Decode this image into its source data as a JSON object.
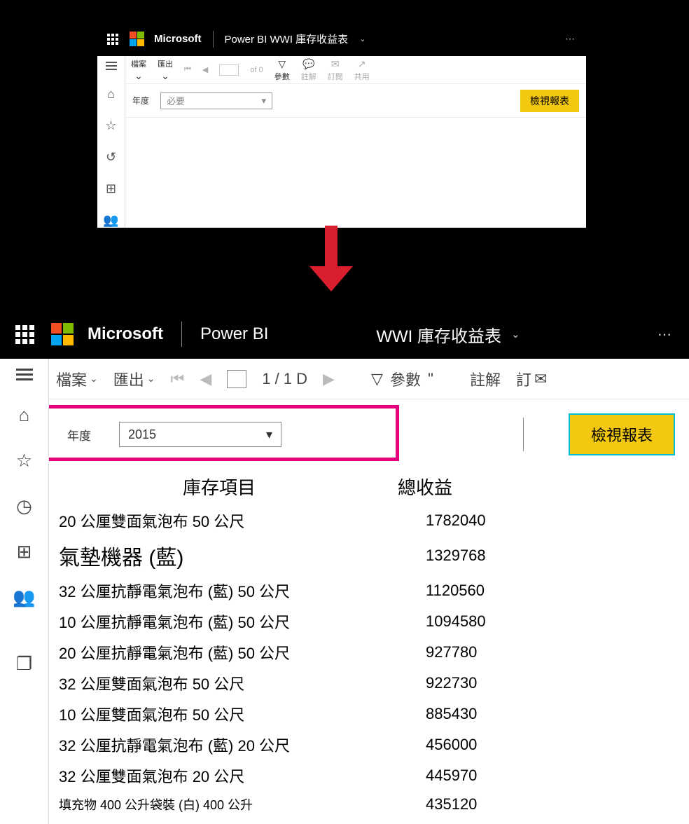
{
  "panel1": {
    "ms_name": "Microsoft",
    "app_title": "Power BI WWI 庫存收益表",
    "toolbar": {
      "file": "檔案",
      "export": "匯出",
      "page_of": "of 0",
      "params": "參數",
      "comments": "註解",
      "subscribe": "訂閱",
      "share": "共用"
    },
    "param_label": "年度",
    "select_placeholder": "必要",
    "view_btn": "檢視報表"
  },
  "panel2": {
    "ms_name": "Microsoft",
    "app_name": "Power BI",
    "report_title": "WWI 庫存收益表",
    "toolbar": {
      "file": "檔案",
      "export": "匯出",
      "pager": "1 / 1 D",
      "params": "參數",
      "comments": "註解",
      "subscribe": "訂"
    },
    "param_label": "年度",
    "select_value": "2015",
    "view_btn": "檢視報表",
    "table": {
      "col_item": "庫存項目",
      "col_revenue": "總收益",
      "rows": [
        {
          "item": "20 公厘雙面氣泡布 50 公尺",
          "rev": "1782040"
        },
        {
          "item": "氣墊機器 (藍)",
          "rev": "1329768",
          "big": true
        },
        {
          "item": "32 公厘抗靜電氣泡布 (藍) 50 公尺",
          "rev": "1120560"
        },
        {
          "item": "10 公厘抗靜電氣泡布 (藍) 50 公尺",
          "rev": "1094580"
        },
        {
          "item": "20 公厘抗靜電氣泡布 (藍) 50 公尺",
          "rev": "927780"
        },
        {
          "item": "32 公厘雙面氣泡布 50 公尺",
          "rev": "922730"
        },
        {
          "item": "10 公厘雙面氣泡布 50 公尺",
          "rev": "885430"
        },
        {
          "item": "32 公厘抗靜電氣泡布 (藍) 20 公尺",
          "rev": "456000"
        },
        {
          "item": "32 公厘雙面氣泡布 20 公尺",
          "rev": "445970"
        },
        {
          "item": "填充物 400 公升袋裝 (白) 400 公升",
          "rev": "435120",
          "small": true
        }
      ]
    }
  }
}
